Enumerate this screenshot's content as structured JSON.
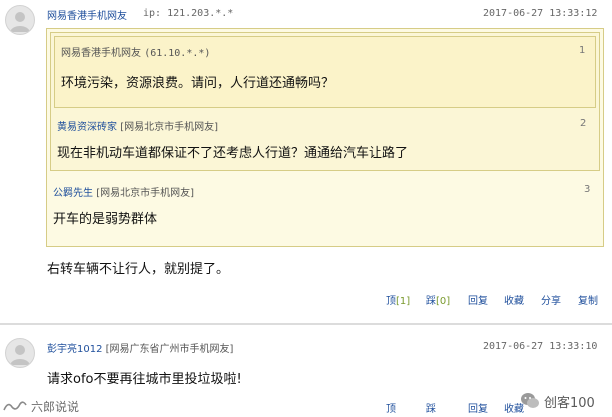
{
  "comment1": {
    "user": "网易香港手机网友",
    "ip": "ip: 121.203.*.*",
    "time": "2017-06-27 13:33:12",
    "text": "右转车辆不让行人，就别提了。",
    "quotes": [
      {
        "floor": "1",
        "user": "网易香港手机网友",
        "source": "(61.10.*.*)",
        "text": "环境污染，资源浪费。请问，人行道还通畅吗？"
      },
      {
        "floor": "2",
        "user": "黄易资深砖家",
        "source": "[网易北京市手机网友]",
        "text": "现在非机动车道都保证不了还考虑人行道？通通给汽车让路了"
      },
      {
        "floor": "3",
        "user": "公羁先生",
        "source": "[网易北京市手机网友]",
        "text": "开车的是弱势群体"
      }
    ],
    "actions": {
      "support_label": "顶",
      "support_count": "[1]",
      "oppose_label": "踩",
      "oppose_count": "[0]",
      "reply": "回复",
      "collect": "收藏",
      "share": "分享",
      "copy": "复制"
    }
  },
  "comment2": {
    "user": "彭宇亮1012",
    "source": "[网易广东省广州市手机网友]",
    "time": "2017-06-27 13:33:10",
    "text": "请求ofo不要再往城市里投垃圾啦!",
    "actions": {
      "support_label": "顶",
      "oppose_label": "踩",
      "reply": "回复",
      "collect": "收藏"
    }
  },
  "watermarks": {
    "left": "六郎说说",
    "right": "创客100"
  }
}
